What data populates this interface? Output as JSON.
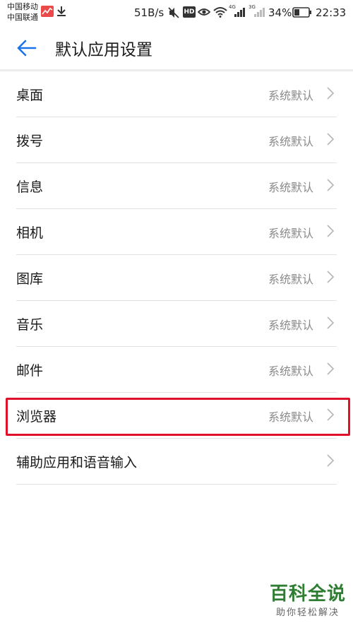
{
  "status_bar": {
    "carrier_1": "中国移动",
    "carrier_2": "中国联通",
    "net_speed": "51B/s",
    "hd_badge": "HD",
    "sim1_tech": "4G",
    "sim2_tech": "3G",
    "battery": "34%",
    "time": "22:33",
    "icons": [
      "stock-chart-icon",
      "download-icon",
      "mute-icon",
      "eye-icon",
      "wifi-icon",
      "signal-icon",
      "battery-icon"
    ]
  },
  "app_bar": {
    "back_icon": "arrow-left-icon",
    "title": "默认应用设置",
    "accent_color": "#1a73e8"
  },
  "settings": {
    "items": [
      {
        "label": "桌面",
        "value": "系统默认"
      },
      {
        "label": "拨号",
        "value": "系统默认"
      },
      {
        "label": "信息",
        "value": "系统默认"
      },
      {
        "label": "相机",
        "value": "系统默认"
      },
      {
        "label": "图库",
        "value": "系统默认"
      },
      {
        "label": "音乐",
        "value": "系统默认"
      },
      {
        "label": "邮件",
        "value": "系统默认"
      },
      {
        "label": "浏览器",
        "value": "系统默认"
      },
      {
        "label": "辅助应用和语音输入",
        "value": ""
      }
    ],
    "highlighted_index": 7,
    "highlight_color": "#e0102a"
  },
  "watermark": {
    "title": "百科全说",
    "subtitle": "助你轻松解决"
  }
}
